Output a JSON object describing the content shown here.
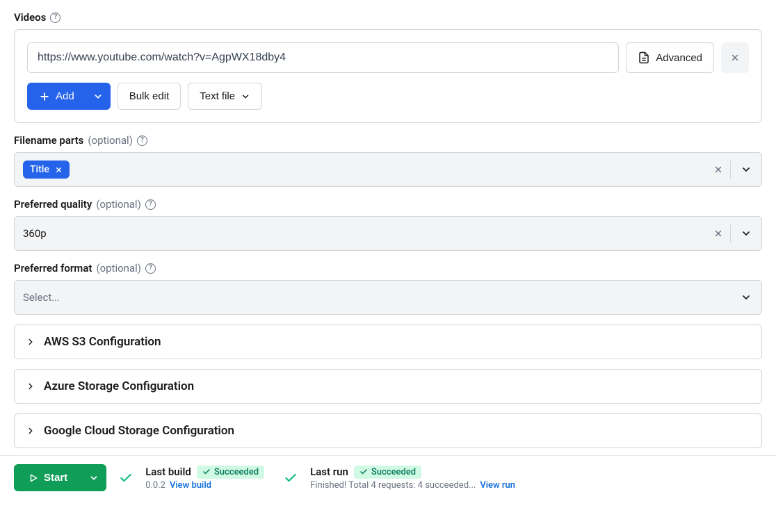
{
  "videos": {
    "label": "Videos",
    "url_value": "https://www.youtube.com/watch?v=AgpWX18dby4",
    "advanced_label": "Advanced",
    "add_label": "Add",
    "bulk_edit_label": "Bulk edit",
    "text_file_label": "Text file"
  },
  "filename_parts": {
    "label": "Filename parts",
    "optional": "(optional)",
    "chip": "Title"
  },
  "preferred_quality": {
    "label": "Preferred quality",
    "optional": "(optional)",
    "value": "360p"
  },
  "preferred_format": {
    "label": "Preferred format",
    "optional": "(optional)",
    "placeholder": "Select..."
  },
  "accordions": {
    "aws": "AWS S3 Configuration",
    "azure": "Azure Storage Configuration",
    "gcs": "Google Cloud Storage Configuration"
  },
  "footer": {
    "start": "Start",
    "last_build": {
      "label": "Last build",
      "status": "Succeeded",
      "version": "0.0.2",
      "link": "View build"
    },
    "last_run": {
      "label": "Last run",
      "status": "Succeeded",
      "message": "Finished! Total 4 requests: 4 succeeded...",
      "link": "View run"
    }
  }
}
